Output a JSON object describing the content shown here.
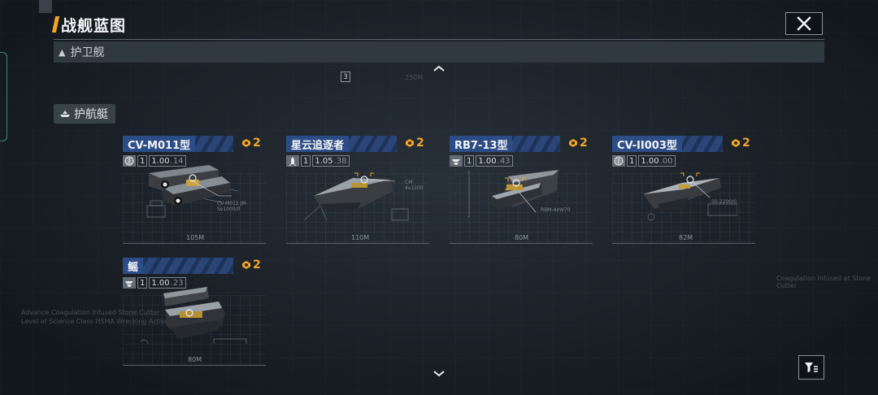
{
  "header": {
    "title": "战舰蓝图",
    "close_icon": "close-icon"
  },
  "category": {
    "label": "护卫舰"
  },
  "subcategory": {
    "label": "护航艇"
  },
  "colors": {
    "accent": "#f0a521",
    "name_plate": "#2c4c86",
    "cost": "#f2a625"
  },
  "ships": [
    {
      "name": "CV-M011型",
      "cost": "2",
      "level": "1",
      "value_main": "1.00",
      "value_dec": ".14",
      "length": "105M",
      "type_icon": "globe-icon",
      "note": "CV-M011 JM-Sv1000/0"
    },
    {
      "name": "星云追逐者",
      "cost": "2",
      "level": "1",
      "value_main": "1.05",
      "value_dec": ".38",
      "length": "110M",
      "type_icon": "missile-icon",
      "note": "CM 4x1200"
    },
    {
      "name": "RB7-13型",
      "cost": "2",
      "level": "1",
      "value_main": "1.00",
      "value_dec": ".43",
      "length": "80M",
      "type_icon": "aircraft-icon",
      "note": "RBM-4xW70"
    },
    {
      "name": "CV-II003型",
      "cost": "2",
      "level": "1",
      "value_main": "1.00",
      "value_dec": ".00",
      "length": "82M",
      "type_icon": "globe-icon",
      "note": "SS-2200/0"
    },
    {
      "name": "鳐",
      "cost": "2",
      "level": "1",
      "value_main": "1.00",
      "value_dec": ".23",
      "length": "80M",
      "type_icon": "aircraft-icon",
      "note": ""
    }
  ],
  "background_text": {
    "left_1": "Advance Coagulation Infused Stone Cutter",
    "left_2": "Level at Science Class HSMA Wrecking Action",
    "right_1": "Coagulation Infused at Stone Cutter",
    "top_mid": "250M",
    "badge": "3"
  }
}
